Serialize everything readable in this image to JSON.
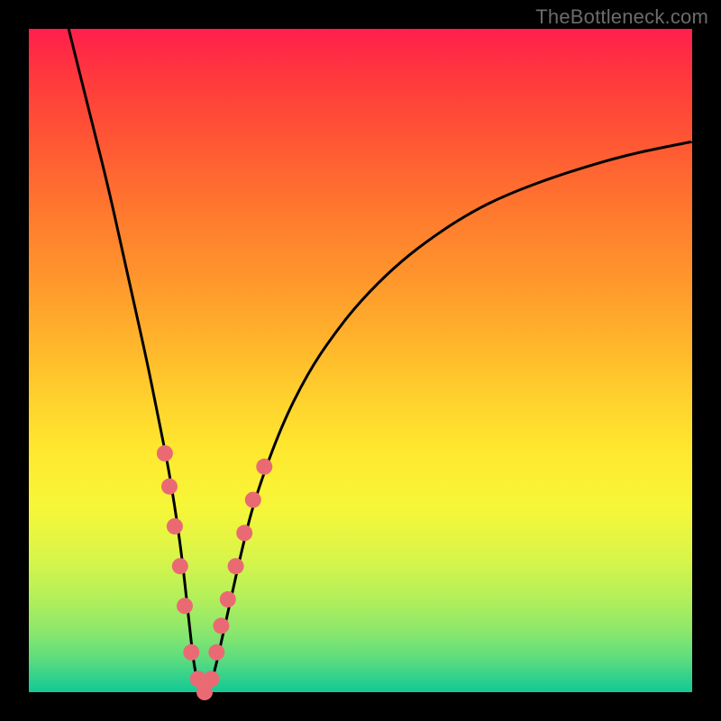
{
  "watermark": {
    "text": "TheBottleneck.com"
  },
  "colors": {
    "frame": "#000000",
    "curve": "#000000",
    "marker": "#ea6a74",
    "gradient_top": "#ff1f4d",
    "gradient_bottom": "#11c996"
  },
  "chart_data": {
    "type": "line",
    "title": "",
    "xlabel": "",
    "ylabel": "",
    "xlim": [
      0,
      100
    ],
    "ylim": [
      0,
      100
    ],
    "grid": false,
    "legend": false,
    "series": [
      {
        "name": "bottleneck-curve",
        "x": [
          6,
          8,
          10,
          12,
          14,
          16,
          18,
          20,
          21,
          22,
          23,
          24,
          25,
          26,
          27,
          28,
          30,
          32,
          34,
          38,
          42,
          46,
          50,
          55,
          60,
          66,
          72,
          80,
          90,
          100
        ],
        "y": [
          100,
          92,
          84,
          76,
          67,
          58,
          49,
          39,
          34,
          28,
          21,
          12,
          3,
          0,
          0,
          3,
          12,
          21,
          29,
          40,
          48,
          54,
          59,
          64,
          68,
          72,
          75,
          78,
          81,
          83
        ]
      }
    ],
    "markers": [
      {
        "x": 20.5,
        "y": 36
      },
      {
        "x": 21.2,
        "y": 31
      },
      {
        "x": 22.0,
        "y": 25
      },
      {
        "x": 22.8,
        "y": 19
      },
      {
        "x": 23.5,
        "y": 13
      },
      {
        "x": 24.5,
        "y": 6
      },
      {
        "x": 25.5,
        "y": 2
      },
      {
        "x": 26.5,
        "y": 0
      },
      {
        "x": 27.5,
        "y": 2
      },
      {
        "x": 28.3,
        "y": 6
      },
      {
        "x": 29.0,
        "y": 10
      },
      {
        "x": 30.0,
        "y": 14
      },
      {
        "x": 31.2,
        "y": 19
      },
      {
        "x": 32.5,
        "y": 24
      },
      {
        "x": 33.8,
        "y": 29
      },
      {
        "x": 35.5,
        "y": 34
      }
    ],
    "notes": "V-shaped bottleneck curve. x is relative component score (≈0–100), y is bottleneck percentage (0 at valley, 100 at top). Values estimated from pixels; no axis ticks visible."
  }
}
